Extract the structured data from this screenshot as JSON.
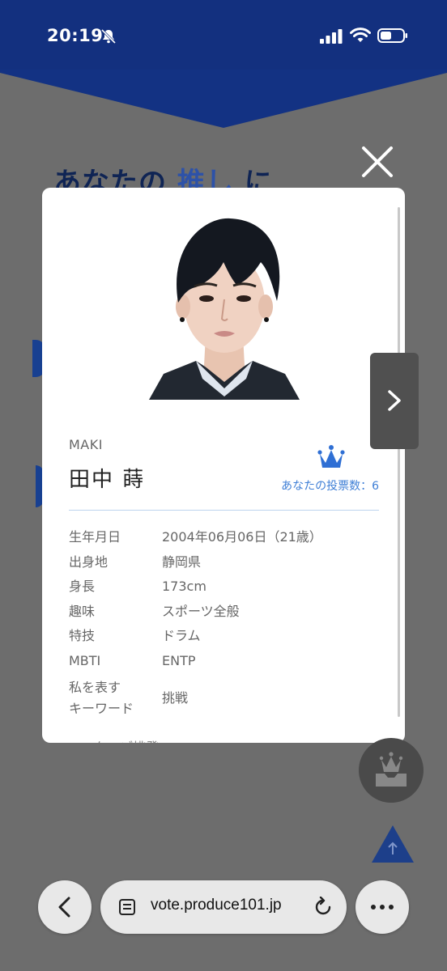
{
  "status_bar": {
    "time": "20:19",
    "icons": [
      "bell-muted-icon",
      "cellular-signal-icon",
      "wifi-icon",
      "battery-icon"
    ]
  },
  "background": {
    "headline_part1": "あなたの",
    "headline_accent": "推し",
    "headline_part2": "に"
  },
  "modal": {
    "name_latin": "MAKI",
    "name_kanji": "田中 蒔",
    "vote_label": "あなたの投票数：",
    "vote_count": "6",
    "profile": [
      {
        "key": "生年月日",
        "value": "2004年06月06日（21歳）"
      },
      {
        "key": "出身地",
        "value": "静岡県"
      },
      {
        "key": "身長",
        "value": "173cm"
      },
      {
        "key": "趣味",
        "value": "スポーツ全般"
      },
      {
        "key": "特技",
        "value": "ドラム"
      },
      {
        "key": "MBTI",
        "value": "ENTP"
      },
      {
        "key_line1": "私を表す",
        "key_line2": "キーワード",
        "value": "挑戦"
      }
    ],
    "cutoff_text": "ニーケーズ挑発"
  },
  "browser": {
    "url": "vote.produce101.jp"
  },
  "colors": {
    "brand_navy": "#13307f",
    "accent_blue": "#3f7fd6",
    "overlay_gray": "#6d6d6d"
  }
}
